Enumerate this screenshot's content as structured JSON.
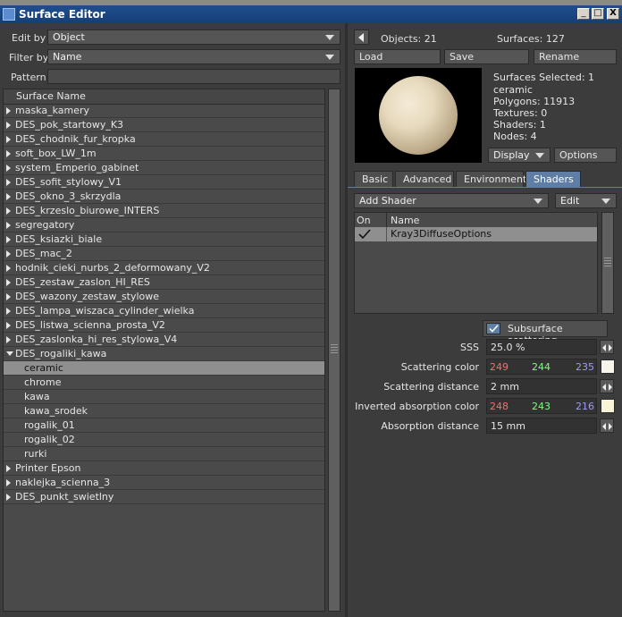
{
  "window": {
    "title": "Surface Editor",
    "min": "_",
    "max": "□",
    "close": "X"
  },
  "left": {
    "edit_by_label": "Edit by",
    "edit_by_value": "Object",
    "filter_by_label": "Filter by",
    "filter_by_value": "Name",
    "pattern_label": "Pattern",
    "pattern_value": "",
    "list_header": "Surface Name",
    "rows": [
      {
        "label": "maska_kamery",
        "kind": "group"
      },
      {
        "label": "DES_pok_startowy_K3",
        "kind": "group"
      },
      {
        "label": "DES_chodnik_fur_kropka",
        "kind": "group"
      },
      {
        "label": "soft_box_LW_1m",
        "kind": "group"
      },
      {
        "label": "system_Emperio_gabinet",
        "kind": "group"
      },
      {
        "label": "DES_sofit_stylowy_V1",
        "kind": "group"
      },
      {
        "label": "DES_okno_3_skrzydla",
        "kind": "group"
      },
      {
        "label": "DES_krzeslo_biurowe_INTERS",
        "kind": "group"
      },
      {
        "label": "segregatory",
        "kind": "group"
      },
      {
        "label": "DES_ksiazki_biale",
        "kind": "group"
      },
      {
        "label": "DES_mac_2",
        "kind": "group"
      },
      {
        "label": "hodnik_cieki_nurbs_2_deformowany_V2",
        "kind": "group"
      },
      {
        "label": "DES_zestaw_zaslon_HI_RES",
        "kind": "group"
      },
      {
        "label": "DES_wazony_zestaw_stylowe",
        "kind": "group"
      },
      {
        "label": "DES_lampa_wiszaca_cylinder_wielka",
        "kind": "group"
      },
      {
        "label": "DES_listwa_scienna_prosta_V2",
        "kind": "group"
      },
      {
        "label": "DES_zaslonka_hi_res_stylowa_V4",
        "kind": "group"
      },
      {
        "label": "DES_rogaliki_kawa",
        "kind": "open"
      },
      {
        "label": "ceramic",
        "kind": "child",
        "selected": true
      },
      {
        "label": "chrome",
        "kind": "child"
      },
      {
        "label": "kawa",
        "kind": "child"
      },
      {
        "label": "kawa_srodek",
        "kind": "child"
      },
      {
        "label": "rogalik_01",
        "kind": "child"
      },
      {
        "label": "rogalik_02",
        "kind": "child"
      },
      {
        "label": "rurki",
        "kind": "child"
      },
      {
        "label": "Printer Epson",
        "kind": "group"
      },
      {
        "label": "naklejka_scienna_3",
        "kind": "group"
      },
      {
        "label": "DES_punkt_swietlny",
        "kind": "group"
      }
    ]
  },
  "right": {
    "objects_label": "Objects: 21",
    "surfaces_label": "Surfaces: 127",
    "load": "Load",
    "save": "Save",
    "rename": "Rename",
    "info": [
      "Surfaces Selected: 1",
      "ceramic",
      "Polygons: 11913",
      "Textures: 0",
      "Shaders: 1",
      "Nodes: 4"
    ],
    "display": "Display",
    "options": "Options",
    "tabs": [
      "Basic",
      "Advanced",
      "Environment",
      "Shaders"
    ],
    "active_tab": "Shaders",
    "add_shader": "Add Shader",
    "edit": "Edit",
    "shader_cols": {
      "on": "On",
      "name": "Name"
    },
    "shader_rows": [
      {
        "on": true,
        "name": "Kray3DiffuseOptions"
      }
    ],
    "sss_checkbox": "Subsurface scattering",
    "props": {
      "sss": {
        "label": "SSS",
        "value": "25.0 %"
      },
      "scatter_color": {
        "label": "Scattering color",
        "r": "249",
        "g": "244",
        "b": "235",
        "swatch": "#f9f4eb"
      },
      "scatter_dist": {
        "label": "Scattering distance",
        "value": "2 mm"
      },
      "inv_abs_color": {
        "label": "Inverted absorption color",
        "r": "248",
        "g": "243",
        "b": "216",
        "swatch": "#f8f3d8"
      },
      "abs_dist": {
        "label": "Absorption distance",
        "value": "15 mm"
      }
    }
  }
}
